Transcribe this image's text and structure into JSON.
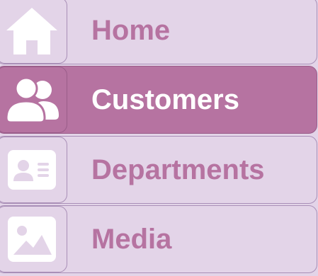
{
  "nav": {
    "items": [
      {
        "label": "Home",
        "icon": "home-icon",
        "active": false
      },
      {
        "label": "Customers",
        "icon": "users-icon",
        "active": true
      },
      {
        "label": "Departments",
        "icon": "id-card-icon",
        "active": false
      },
      {
        "label": "Media",
        "icon": "image-icon",
        "active": false
      }
    ]
  },
  "colors": {
    "background": "#e3d4e8",
    "accent": "#b673a1",
    "border": "#a98fb7",
    "icon": "#ffffff"
  }
}
